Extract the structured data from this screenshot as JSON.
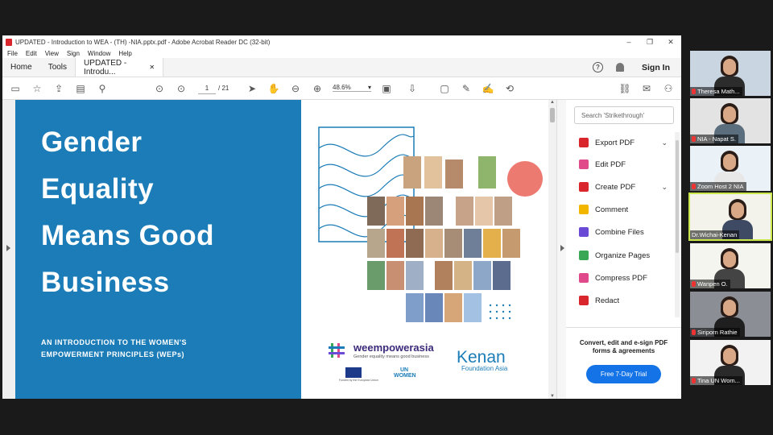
{
  "window": {
    "title": "UPDATED - Introduction to WEA - (TH) -NIA.pptx.pdf - Adobe Acrobat Reader DC (32-bit)",
    "controls": [
      "–",
      "❐",
      "✕"
    ]
  },
  "menu": [
    "File",
    "Edit",
    "View",
    "Sign",
    "Window",
    "Help"
  ],
  "tabs": {
    "home": "Home",
    "tools": "Tools",
    "doc": "UPDATED - Introdu...",
    "close": "✕",
    "signin": "Sign In",
    "help": "?"
  },
  "toolbar": {
    "page_current": "1",
    "page_total": "/ 21",
    "zoom": "48.6%",
    "zoom_caret": "▾"
  },
  "slide": {
    "headline": [
      "Gender",
      "Equality",
      "Means Good",
      "Business"
    ],
    "subtitle": [
      "AN INTRODUCTION TO THE WOMEN'S",
      "EMPOWERMENT PRINCIPLES (WEPs)"
    ],
    "brand": "weempowerasia",
    "brand_tagline": "Gender equality means good business",
    "kenan": "Kenan",
    "kenan_sub": "Foundation Asia",
    "un_women": [
      "UN",
      "WOMEN"
    ],
    "eu_caption": "Funded by the European Union"
  },
  "right_pane": {
    "search_placeholder": "Search 'Strikethrough'",
    "tools": [
      {
        "label": "Export PDF",
        "color": "#d9262c",
        "chevron": true
      },
      {
        "label": "Edit PDF",
        "color": "#e04a8a",
        "chevron": false
      },
      {
        "label": "Create PDF",
        "color": "#d9262c",
        "chevron": true
      },
      {
        "label": "Comment",
        "color": "#f2b600",
        "chevron": false
      },
      {
        "label": "Combine Files",
        "color": "#6a4bd6",
        "chevron": false
      },
      {
        "label": "Organize Pages",
        "color": "#3aa757",
        "chevron": false
      },
      {
        "label": "Compress PDF",
        "color": "#e04a8a",
        "chevron": false
      },
      {
        "label": "Redact",
        "color": "#d9262c",
        "chevron": false
      }
    ],
    "promo_text": [
      "Convert, edit and e-sign PDF",
      "forms & agreements"
    ],
    "promo_button": "Free 7-Day Trial"
  },
  "participants": [
    {
      "name": "Theresa Math...",
      "bg": "#c9d6e2",
      "active": false
    },
    {
      "name": "NIA - Napat S.",
      "bg": "#e3e3e3",
      "active": false
    },
    {
      "name": "Zoom Host 2 NIA",
      "bg": "#eaf1f7",
      "active": false
    },
    {
      "name": "Dr.Wichai-Kenan",
      "bg": "#f3f3ec",
      "active": true
    },
    {
      "name": "Wanpen O.",
      "bg": "#f5f5f0",
      "active": false
    },
    {
      "name": "Siriporn Rathie",
      "bg": "#8b8e94",
      "active": false
    },
    {
      "name": "Tina UN Wom...",
      "bg": "#f2f2f2",
      "active": false
    }
  ]
}
